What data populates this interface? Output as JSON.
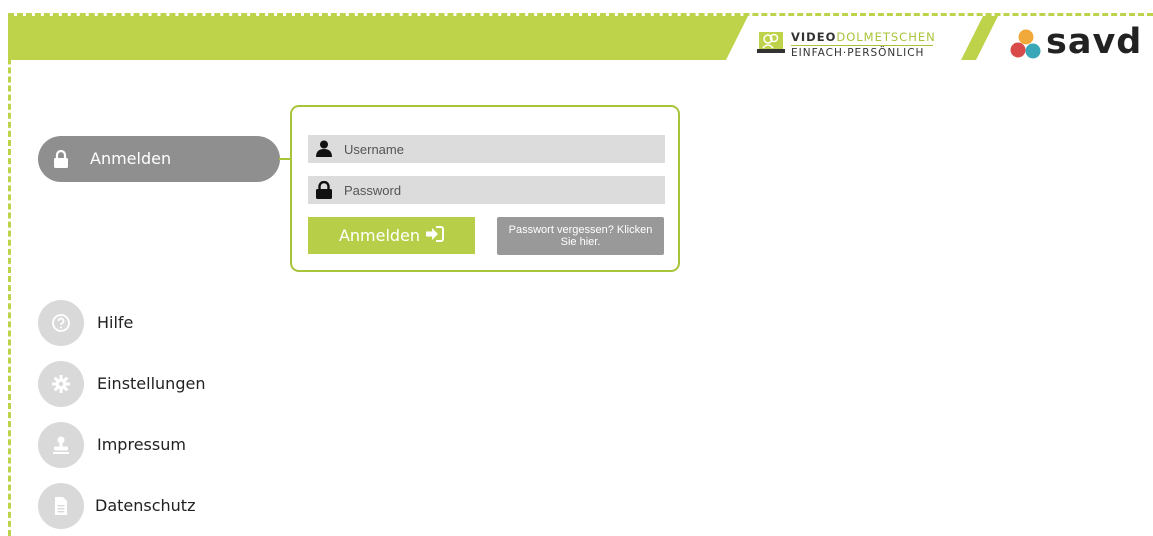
{
  "header": {
    "brand_line1_bold": "VIDEO",
    "brand_line1_green": "DOLMETSCHEN",
    "brand_line2": "EINFACH·PERSÖNLICH",
    "savd_logo_text": "savd",
    "accent_color": "#a8c43a"
  },
  "nav": {
    "active": {
      "label": "Anmelden",
      "icon": "lock-icon"
    },
    "items": [
      {
        "label": "Hilfe",
        "icon": "help-icon"
      },
      {
        "label": "Einstellungen",
        "icon": "gear-icon"
      },
      {
        "label": "Impressum",
        "icon": "stamp-icon"
      },
      {
        "label": "Datenschutz",
        "icon": "document-icon"
      }
    ]
  },
  "login": {
    "username_placeholder": "Username",
    "password_placeholder": "Password",
    "login_button_label": "Anmelden",
    "forgot_label": "Passwort vergessen? Klicken Sie hier."
  }
}
